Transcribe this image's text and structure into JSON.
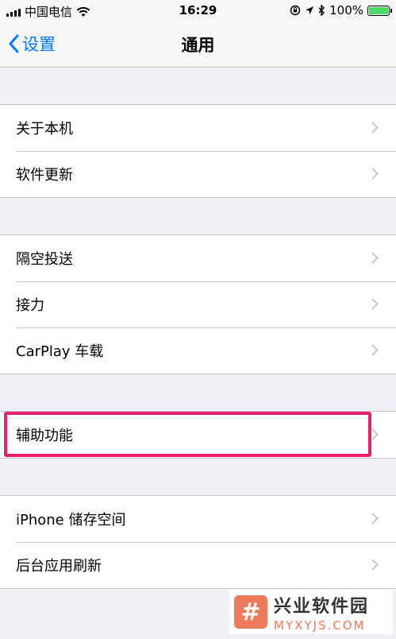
{
  "status_bar": {
    "carrier": "中国电信",
    "time": "16:29",
    "battery": "100%"
  },
  "nav": {
    "back_label": "设置",
    "title": "通用"
  },
  "groups": [
    {
      "items": [
        {
          "label": "关于本机"
        },
        {
          "label": "软件更新"
        }
      ]
    },
    {
      "items": [
        {
          "label": "隔空投送"
        },
        {
          "label": "接力"
        },
        {
          "label": "CarPlay 车载"
        }
      ]
    },
    {
      "items": [
        {
          "label": "辅助功能",
          "highlighted": true
        }
      ]
    },
    {
      "items": [
        {
          "label": "iPhone 储存空间"
        },
        {
          "label": "后台应用刷新"
        }
      ]
    }
  ],
  "watermark": {
    "title": "兴业软件园",
    "url": "MYXYJS.COM",
    "logo_glyph": "#"
  },
  "colors": {
    "accent": "#007aff",
    "highlight": "#ef1f66",
    "watermark": "#ef7a5b"
  }
}
